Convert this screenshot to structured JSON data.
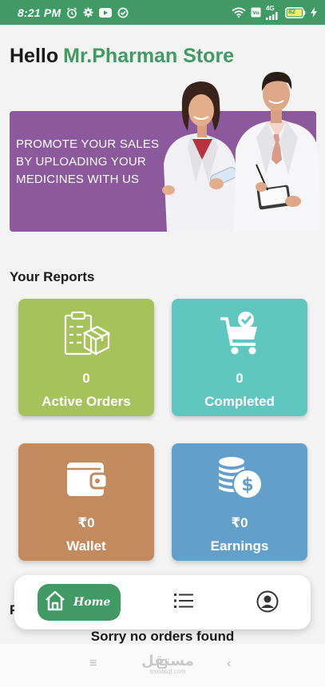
{
  "status_bar": {
    "time": "8:21 PM",
    "network_label": "4G",
    "battery_level": "82",
    "icons": [
      "alarm-icon",
      "gear-icon",
      "youtube-icon",
      "data-saver-icon",
      "wifi-icon",
      "volte-icon",
      "signal-icon",
      "battery-icon",
      "charging-icon"
    ],
    "background": "#3f9a63"
  },
  "header": {
    "greeting": "Hello",
    "store_name": "Mr.Pharman Store",
    "accent_color": "#3f9a63"
  },
  "banner": {
    "line1": "PROMOTE YOUR SALES",
    "line2": "BY UPLOADING YOUR",
    "line3": "MEDICINES WITH US",
    "background": "#8c5a9c"
  },
  "reports": {
    "title": "Your Reports",
    "cards": [
      {
        "label": "Active Orders",
        "value": "0",
        "icon": "clipboard-box-icon",
        "color": "#a6c35b"
      },
      {
        "label": "Completed",
        "value": "0",
        "icon": "cart-check-icon",
        "color": "#5fc6c0"
      },
      {
        "label": "Wallet",
        "value": "₹0",
        "icon": "wallet-icon",
        "color": "#c38a5d"
      },
      {
        "label": "Earnings",
        "value": "₹0",
        "icon": "coins-dollar-icon",
        "color": "#62a0cb"
      }
    ]
  },
  "orders": {
    "heading_partial": "P",
    "empty_message": "Sorry no orders found"
  },
  "bottom_nav": {
    "home_label": "Home",
    "items": [
      "home-icon",
      "list-icon",
      "profile-icon"
    ]
  },
  "system_nav": {
    "watermark_main": "مستقل",
    "watermark_sub": "mostaql.com"
  }
}
